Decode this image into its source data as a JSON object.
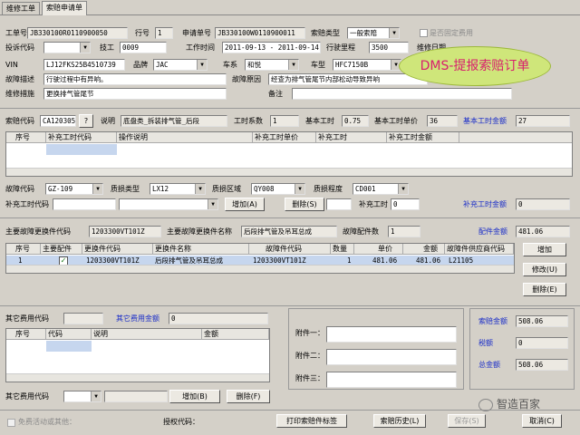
{
  "tabs": [
    "维修工单",
    "索赔申请单"
  ],
  "header": {
    "work_order_label": "工单号",
    "work_order": "JB330100R0110900050",
    "line_label": "行号",
    "line": "1",
    "app_no_label": "申请单号",
    "app_no": "JB330100W0110900011",
    "claim_type_label": "索赔类型",
    "claim_type": "一般索赔",
    "fixed_fee_label": "是否固定费用",
    "complaint_label": "投诉代码",
    "tech_label": "技工",
    "tech": "0009",
    "work_time_label": "工作时间",
    "work_time": "2011-09-13 - 2011-09-14",
    "mileage_label": "行驶里程",
    "mileage": "3500",
    "repair_label": "维修日期",
    "vin_label": "VIN",
    "vin": "LJ12FKS25B4510739",
    "brand_label": "品牌",
    "brand": "JAC",
    "series_label": "车系",
    "series": "和悦",
    "model_label": "车型",
    "model": "HFC7150B",
    "fault_desc_label": "故障描述",
    "fault_desc": "行驶过程中有异响。",
    "fault_cause_label": "故障原因",
    "fault_cause": "经查为排气管尾节内部松动导致异响",
    "measure_label": "维修措施",
    "measure": "更换排气管尾节",
    "remark_label": "备注",
    "remark": ""
  },
  "overlay": "DMS-提报索赔订单",
  "claim": {
    "code_label": "索赔代码",
    "code": "CA120305",
    "desc_label": "说明",
    "desc": "底盘类_拆装排气管_后段",
    "coef_label": "工时系数",
    "coef": "1",
    "base_hours_label": "基本工时",
    "base_hours": "0.75",
    "base_price_label": "基本工时单价",
    "base_price": "36",
    "base_amount_label": "基本工时金额",
    "base_amount": "27"
  },
  "labor_grid": {
    "headers": [
      "序号",
      "补充工时代码",
      "操作说明",
      "补充工时单价",
      "补充工时",
      "补充工时金额"
    ]
  },
  "fault": {
    "code_label": "故障代码",
    "code": "GZ-109",
    "damage_type_label": "质损类型",
    "damage_type": "LX12",
    "damage_area_label": "质损区域",
    "damage_area": "QY008",
    "damage_level_label": "质损程度",
    "damage_level": "CD001",
    "extra_code_label": "补充工时代码",
    "add_label": "增加(A)",
    "delete_label": "删除(S)",
    "extra_hours_label": "补充工时",
    "extra_hours": "0",
    "extra_amount_label": "补充工时金额",
    "extra_amount": "0"
  },
  "parts": {
    "main_code_label": "主要故障更换件代码",
    "main_code": "1203300VT101Z",
    "main_name_label": "主要故障更换件名称",
    "main_name": "后段排气管及吊耳总成",
    "count_label": "故障配件数",
    "count": "1",
    "amount_label": "配件金额",
    "amount": "481.06",
    "headers": [
      "序号",
      "主要配件",
      "更换件代码",
      "更换件名称",
      "故障件代码",
      "数量",
      "单价",
      "金额",
      "故障件供应商代码"
    ],
    "rows": [
      {
        "seq": "1",
        "main": "✓",
        "code": "1203300VT101Z",
        "name": "后段排气管及吊耳总成",
        "fault_code": "1203300VT101Z",
        "qty": "1",
        "price": "481.06",
        "amount": "481.06",
        "supplier": "L21105"
      }
    ],
    "add_label": "增加",
    "modify_label": "修改(U)",
    "delete_label": "删除(E)"
  },
  "other": {
    "code_label": "其它费用代码",
    "amount_label": "其它费用金额",
    "amount": "0",
    "headers": [
      "序号",
      "代码",
      "说明",
      "金额"
    ],
    "code2_label": "其它费用代码",
    "add_label": "增加(B)",
    "delete_label": "删除(F)"
  },
  "attachments": [
    "附件一：",
    "附件二：",
    "附件三："
  ],
  "totals": {
    "claim_label": "索赔金额",
    "claim": "508.06",
    "tax_label": "税额",
    "tax": "0",
    "total_label": "总金额",
    "total": "508.06"
  },
  "footer": {
    "free_label": "免费活动或其他：",
    "auth_label": "授权代码：",
    "print_label": "打印索赔件标签",
    "history_label": "索赔历史(L)",
    "save_label": "保存(S)",
    "cancel_label": "取消(C)"
  },
  "watermark": "智造百家"
}
